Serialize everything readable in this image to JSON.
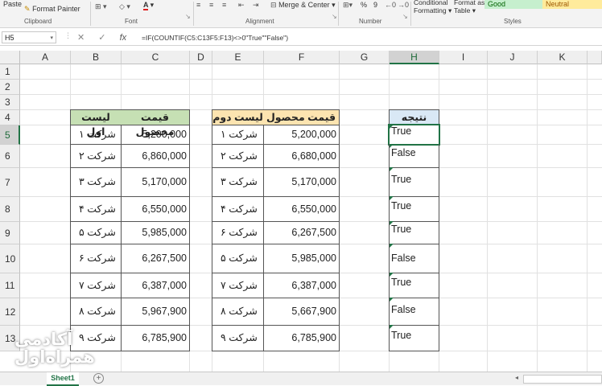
{
  "ribbon": {
    "paste": "Paste",
    "format_painter": "Format Painter",
    "clipboard": "Clipboard",
    "font": "Font",
    "merge_center": "Merge & Center",
    "alignment": "Alignment",
    "percent": "%",
    "comma": "9",
    "number": "Number",
    "conditional_formatting_1": "Conditional",
    "conditional_formatting_2": "Formatting",
    "format_as_table_1": "Format as",
    "format_as_table_2": "Table",
    "style_good": "Good",
    "style_neutral": "Neutral",
    "styles": "Styles"
  },
  "formula_bar": {
    "name_box": "H5",
    "cancel_icon": "✕",
    "enter_icon": "✓",
    "fx_icon": "fx",
    "formula": "=IF(COUNTIF(C5:C13F5:F13)<>0\"True\"\"False\")"
  },
  "columns": [
    "A",
    "B",
    "C",
    "D",
    "E",
    "F",
    "G",
    "H",
    "I",
    "J",
    "K"
  ],
  "rows": [
    "1",
    "2",
    "3",
    "4",
    "5",
    "6",
    "7",
    "8",
    "9",
    "10",
    "11",
    "12",
    "13"
  ],
  "table1": {
    "header_name": "لیست اول",
    "header_price": "قیمت محصول",
    "names": [
      "شرکت ۱",
      "شرکت ۲",
      "شرکت ۳",
      "شرکت ۴",
      "شرکت ۵",
      "شرکت ۶",
      "شرکت ۷",
      "شرکت ۸",
      "شرکت ۹"
    ],
    "prices": [
      "5,200,000",
      "6,860,000",
      "5,170,000",
      "6,550,000",
      "5,985,000",
      "6,267,500",
      "6,387,000",
      "5,967,900",
      "6,785,900"
    ]
  },
  "table2": {
    "header_name": "لیست دوم",
    "header_price": "قیمت محصول",
    "names": [
      "شرکت ۱",
      "شرکت ۲",
      "شرکت ۳",
      "شرکت ۴",
      "شرکت ۶",
      "شرکت ۵",
      "شرکت ۷",
      "شرکت ۸",
      "شرکت ۹"
    ],
    "prices": [
      "5,200,000",
      "6,680,000",
      "5,170,000",
      "6,550,000",
      "6,267,500",
      "5,985,000",
      "6,387,000",
      "5,667,900",
      "6,785,900"
    ]
  },
  "result": {
    "header": "نتیجه",
    "values": [
      "True",
      "False",
      "True",
      "True",
      "True",
      "False",
      "True",
      "False",
      "True"
    ]
  },
  "sheet_tab": "Sheet1",
  "add_sheet": "+",
  "logo": {
    "line1": "آکادمی",
    "line2": "همراه‌اول"
  },
  "colors": {
    "excel_green": "#217346",
    "header_green": "#c6e0b4",
    "header_yellow": "#fce4b0",
    "header_blue": "#d9e8f5",
    "style_good": "#c6efce",
    "style_neutral": "#ffeb9c"
  }
}
